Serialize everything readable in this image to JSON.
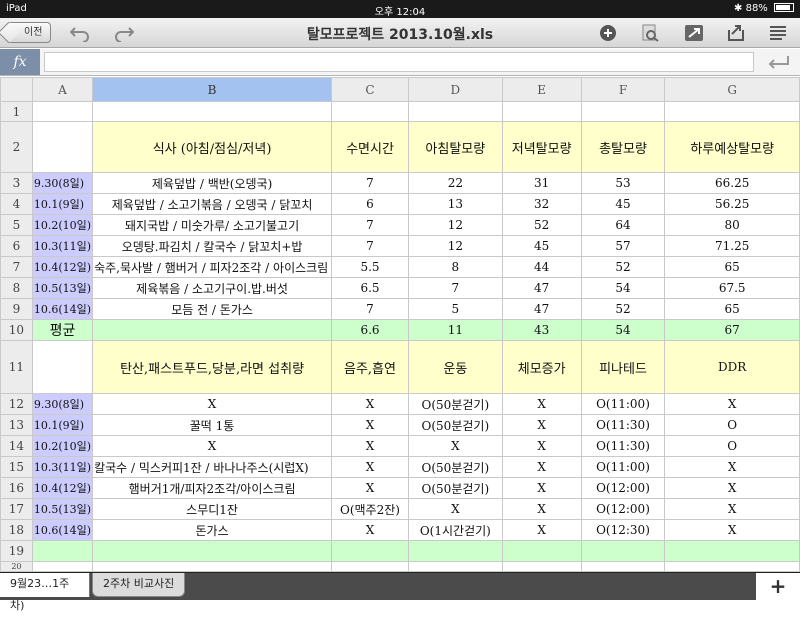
{
  "status": {
    "device": "iPad",
    "time": "오후 12:04",
    "battery": "88%"
  },
  "toolbar": {
    "back_label": "이전",
    "title": "탈모프로젝트 2013.10월.xls"
  },
  "formula": {
    "fx": "fx",
    "value": ""
  },
  "columns": [
    "A",
    "B",
    "C",
    "D",
    "E",
    "F",
    "G"
  ],
  "selected_column": "B",
  "rows": {
    "r1": {
      "num": "1"
    },
    "r2": {
      "num": "2",
      "b": "식사 (아침/점심/저녁)",
      "c": "수면시간",
      "d": "아침탈모량",
      "e": "저녁탈모량",
      "f": "총탈모량",
      "g": "하루예상탈모량"
    },
    "r3": {
      "num": "3",
      "a": "9.30(8일)",
      "b": "제육덮밥 / 백반(오뎅국)",
      "c": "7",
      "d": "22",
      "e": "31",
      "f": "53",
      "g": "66.25"
    },
    "r4": {
      "num": "4",
      "a": "10.1(9일)",
      "b": "제육덮밥 / 소고기볶음 / 오뎅국 / 닭꼬치",
      "c": "6",
      "d": "13",
      "e": "32",
      "f": "45",
      "g": "56.25"
    },
    "r5": {
      "num": "5",
      "a": "10.2(10일)",
      "b": "돼지국밥 / 미숫가루/ 소고기불고기",
      "c": "7",
      "d": "12",
      "e": "52",
      "f": "64",
      "g": "80"
    },
    "r6": {
      "num": "6",
      "a": "10.3(11일)",
      "b": "오뎅탕.파김치 / 칼국수 / 닭꼬치+밥",
      "c": "7",
      "d": "12",
      "e": "45",
      "f": "57",
      "g": "71.25"
    },
    "r7": {
      "num": "7",
      "a": "10.4(12일)",
      "b": "숙주,묵사발 / 햄버거 / 피자2조각 / 아이스크림",
      "c": "5.5",
      "d": "8",
      "e": "44",
      "f": "52",
      "g": "65"
    },
    "r8": {
      "num": "8",
      "a": "10.5(13일)",
      "b": "제육볶음 / 소고기구이.밥.버섯",
      "c": "6.5",
      "d": "7",
      "e": "47",
      "f": "54",
      "g": "67.5"
    },
    "r9": {
      "num": "9",
      "a": "10.6(14일)",
      "b": "모듬 전 / 돈가스",
      "c": "7",
      "d": "5",
      "e": "47",
      "f": "52",
      "g": "65"
    },
    "r10": {
      "num": "10",
      "a": "평균",
      "c": "6.6",
      "d": "11",
      "e": "43",
      "f": "54",
      "g": "67"
    },
    "r11": {
      "num": "11",
      "b": "탄산,패스트푸드,당분,라면 섭취량",
      "c": "음주,흡연",
      "d": "운동",
      "e": "체모증가",
      "f": "피나테드",
      "g": "DDR"
    },
    "r12": {
      "num": "12",
      "a": "9.30(8일)",
      "b": "X",
      "c": "X",
      "d": "O(50분걷기)",
      "e": "X",
      "f": "O(11:00)",
      "g": "X"
    },
    "r13": {
      "num": "13",
      "a": "10.1(9일)",
      "b": "꿀떡 1통",
      "c": "X",
      "d": "O(50분걷기)",
      "e": "X",
      "f": "O(11:30)",
      "g": "O"
    },
    "r14": {
      "num": "14",
      "a": "10.2(10일)",
      "b": "X",
      "c": "X",
      "d": "X",
      "e": "X",
      "f": "O(11:30)",
      "g": "O"
    },
    "r15": {
      "num": "15",
      "a": "10.3(11일)",
      "b": "칼국수 / 믹스커피1잔 / 바나나주스(시럽X)",
      "c": "X",
      "d": "O(50분걷기)",
      "e": "X",
      "f": "O(11:00)",
      "g": "X"
    },
    "r16": {
      "num": "16",
      "a": "10.4(12일)",
      "b": "햄버거1개/피자2조각/아이스크림",
      "c": "X",
      "d": "O(50분걷기)",
      "e": "X",
      "f": "O(12:00)",
      "g": "X"
    },
    "r17": {
      "num": "17",
      "a": "10.5(13일)",
      "b": "스무디1잔",
      "c": "O(맥주2잔)",
      "d": "X",
      "e": "X",
      "f": "O(12:00)",
      "g": "X"
    },
    "r18": {
      "num": "18",
      "a": "10.6(14일)",
      "b": "돈가스",
      "c": "X",
      "d": "O(1시간걷기)",
      "e": "X",
      "f": "O(12:30)",
      "g": "X"
    },
    "r19": {
      "num": "19"
    },
    "r20": {
      "num": "20"
    }
  },
  "sheets": {
    "active": "9월23…1주차)",
    "other": "2주차 비교사진",
    "add": "+"
  }
}
